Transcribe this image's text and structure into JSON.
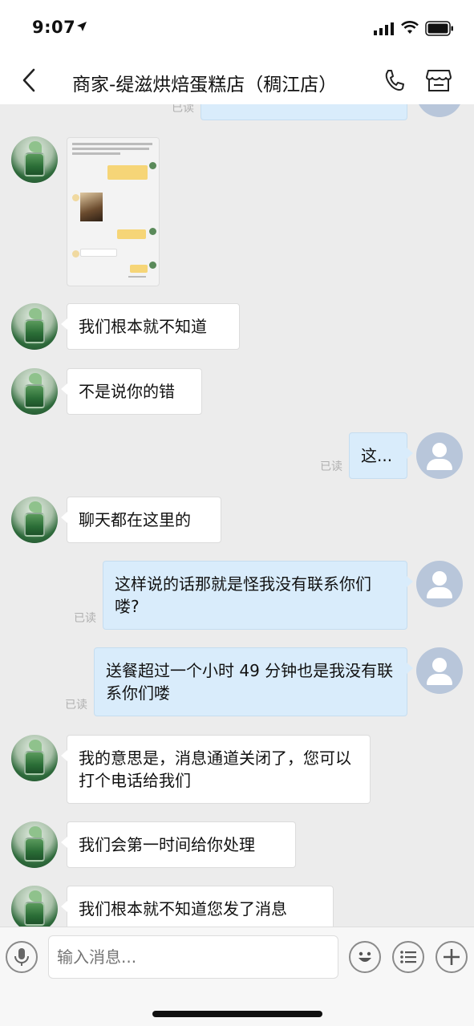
{
  "status": {
    "time": "9:07"
  },
  "nav": {
    "title": "商家-缇滋烘焙蛋糕店（稠江店）"
  },
  "chat": {
    "top_read": "已读",
    "messages": [
      {
        "side": "left",
        "type": "image"
      },
      {
        "side": "left",
        "text": "我们根本就不知道"
      },
      {
        "side": "left",
        "text": "不是说你的错"
      },
      {
        "side": "right",
        "text": "这...",
        "read": "已读"
      },
      {
        "side": "left",
        "text": "聊天都在这里的"
      },
      {
        "side": "right",
        "text": "这样说的话那就是怪我没有联系你们喽?",
        "read": "已读"
      },
      {
        "side": "right",
        "text": "送餐超过一个小时 49 分钟也是我没有联系你们喽",
        "read": "已读"
      },
      {
        "side": "left",
        "text": "我的意思是，消息通道关闭了，您可以打个电话给我们"
      },
      {
        "side": "left",
        "text": "我们会第一时间给你处理"
      },
      {
        "side": "left",
        "text": "我们根本就不知道您发了消息"
      }
    ]
  },
  "input": {
    "placeholder": "输入消息..."
  },
  "icons": {
    "back": "chevron-left-icon",
    "phone": "phone-icon",
    "shop": "shop-icon",
    "voice": "microphone-icon",
    "emoji": "emoji-icon",
    "menu": "list-icon",
    "add": "plus-icon"
  },
  "colors": {
    "bubble_self": "#d9ecfb",
    "bubble_other": "#ffffff",
    "background": "#ececec"
  }
}
